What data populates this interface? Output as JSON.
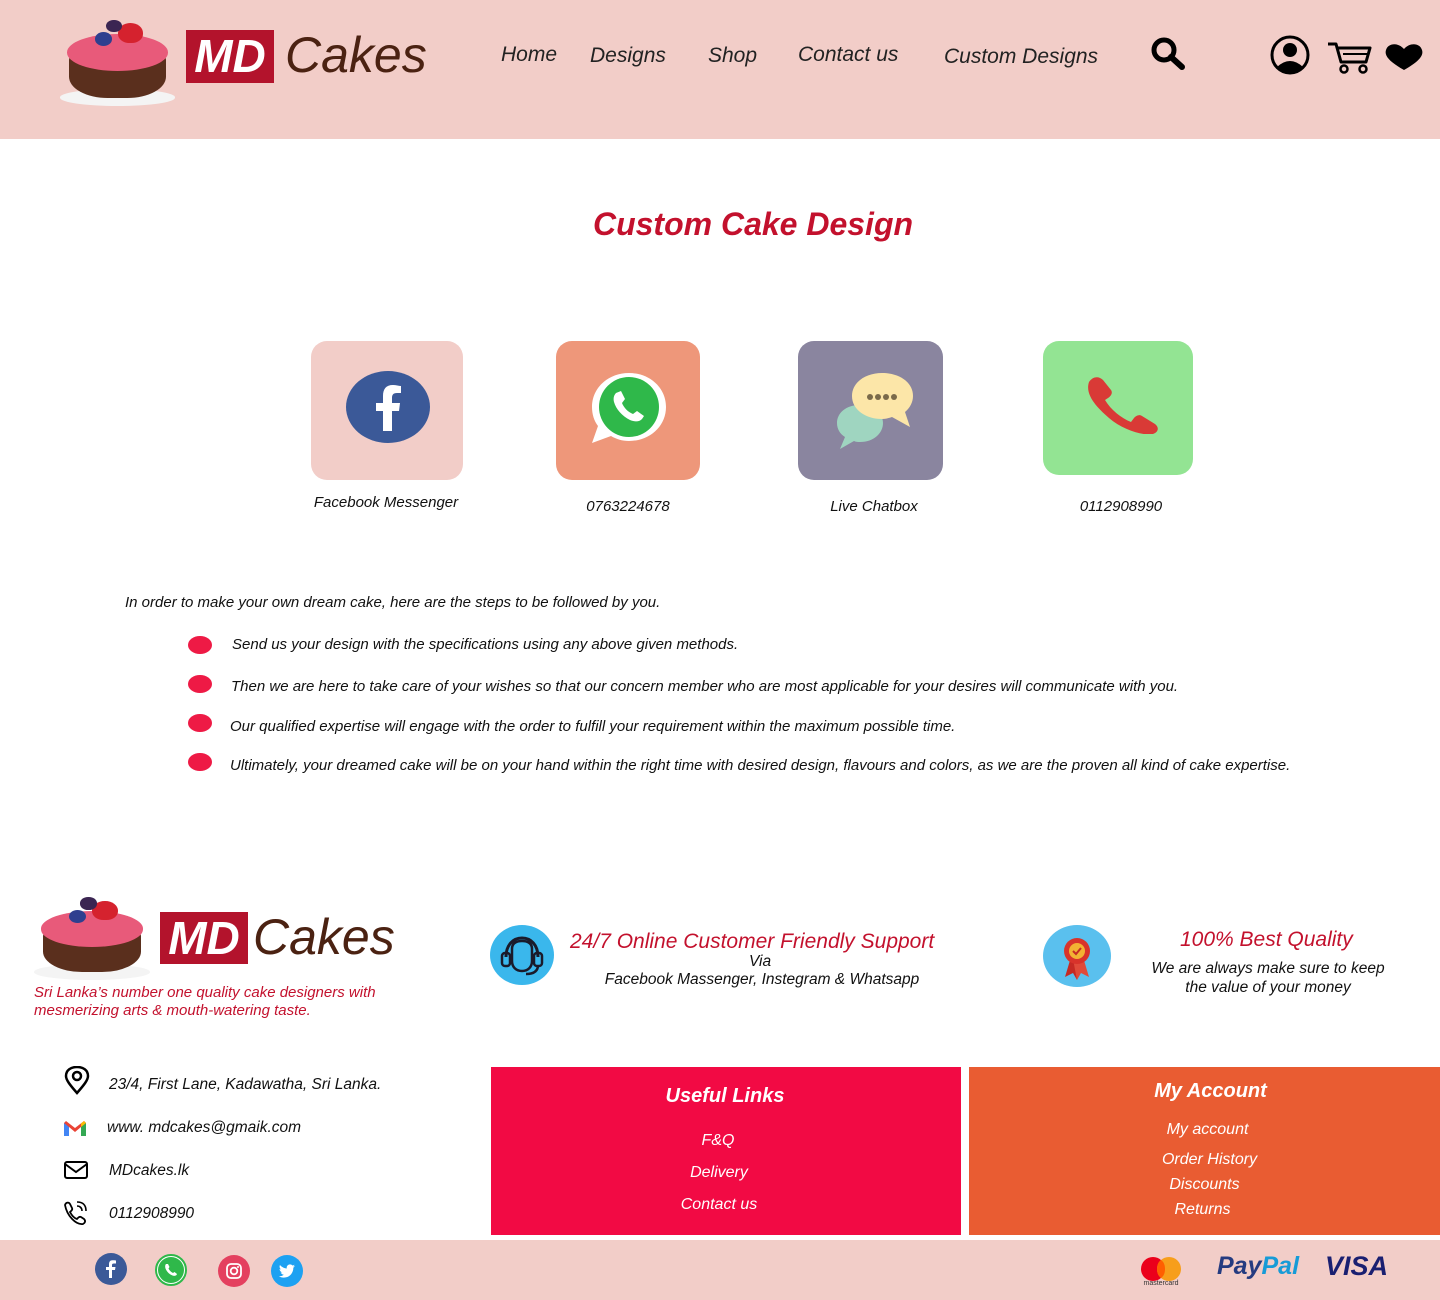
{
  "brand": {
    "md": "MD",
    "name": "Cakes"
  },
  "nav": {
    "items": [
      {
        "label": "Home"
      },
      {
        "label": "Designs"
      },
      {
        "label": "Shop"
      },
      {
        "label": "Contact us"
      },
      {
        "label": "Custom Designs"
      }
    ],
    "icons": [
      "search-icon",
      "user-icon",
      "cart-icon",
      "heart-icon"
    ]
  },
  "main": {
    "title": "Custom Cake Design",
    "contacts": [
      {
        "label": "Facebook Messenger",
        "icon": "facebook-icon",
        "color": "#f2cdc8"
      },
      {
        "label": "0763224678",
        "icon": "whatsapp-icon",
        "color": "#ee977a"
      },
      {
        "label": "Live Chatbox",
        "icon": "chat-icon",
        "color": "#8a859f"
      },
      {
        "label": "0112908990",
        "icon": "phone-icon",
        "color": "#93e493"
      }
    ],
    "steps_intro": "In order to make your own dream cake, here are the steps to be followed by you.",
    "steps": [
      "Send us your design with the specifications using any above given methods.",
      "Then we are here to take care of your wishes so that our concern member  who are most applicable for your desires will communicate with you.",
      "Our qualified expertise will engage with the order to fulfill your requirement within the  maximum possible time.",
      "Ultimately, your dreamed cake will be on your hand within the right time with desired design, flavours and colors, as we are the proven all kind of cake expertise."
    ]
  },
  "footer": {
    "tagline": "Sri Lanka’s number one quality cake designers with mesmerizing arts & mouth-watering taste.",
    "support": {
      "title": "24/7  Online Customer Friendly Support",
      "via": "Via",
      "channels": "Facebook Massenger, Instegram & Whatsapp"
    },
    "quality": {
      "title": "100% Best Quality",
      "line1": "We are always make sure to keep",
      "line2": "the value of your money"
    },
    "contact_info": {
      "address": "23/4, First Lane, Kadawatha, Sri Lanka.",
      "email": "www. mdcakes@gmaik.com",
      "website": "MDcakes.lk",
      "phone": "0112908990"
    },
    "useful_links": {
      "title": "Useful Links",
      "links": [
        "F&Q",
        "Delivery",
        "Contact us"
      ]
    },
    "my_account": {
      "title": "My Account",
      "links": [
        "My account",
        "Order History",
        "Discounts",
        "Returns"
      ]
    },
    "social": [
      "facebook-icon",
      "whatsapp-icon",
      "instagram-icon",
      "twitter-icon"
    ],
    "payments": {
      "mastercard": "mastercard",
      "paypal_pay": "Pay",
      "paypal_pal": "Pal",
      "visa": "VISA"
    }
  },
  "colors": {
    "header_bg": "#f2cdc8",
    "brand_red": "#b3132c",
    "title_red": "#c3112d",
    "bullet": "#ee1a45",
    "useful_bg": "#f20a44",
    "account_bg": "#e95c32"
  }
}
